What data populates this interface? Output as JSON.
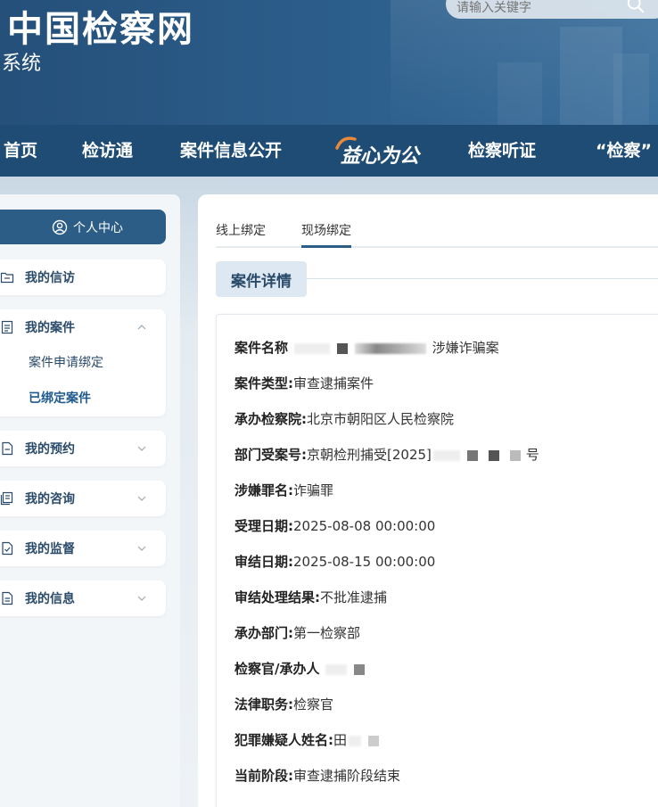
{
  "header": {
    "title": "中国检察网",
    "subtitle": "系统",
    "search_placeholder": "请输入关键字"
  },
  "nav": {
    "items": [
      {
        "label": "首页"
      },
      {
        "label": "检访通"
      },
      {
        "label": "案件信息公开"
      },
      {
        "label": "益心为公"
      },
      {
        "label": "检察听证"
      },
      {
        "label": "“检察”"
      }
    ]
  },
  "sidebar": {
    "personal_center": "个人中心",
    "menus": [
      {
        "label": "我的信访",
        "icon": "folder-icon"
      },
      {
        "label": "我的案件",
        "icon": "document-icon",
        "expanded": true,
        "children": [
          {
            "label": "案件申请绑定"
          },
          {
            "label": "已绑定案件"
          }
        ]
      },
      {
        "label": "我的预约",
        "icon": "calendar-doc-icon"
      },
      {
        "label": "我的咨询",
        "icon": "consult-icon"
      },
      {
        "label": "我的监督",
        "icon": "check-doc-icon"
      },
      {
        "label": "我的信息",
        "icon": "info-doc-icon"
      }
    ]
  },
  "main": {
    "tabs": [
      {
        "label": "线上绑定"
      },
      {
        "label": "现场绑定"
      }
    ],
    "active_tab": 1,
    "section_title": "案件详情",
    "details": [
      {
        "label": "案件名称",
        "value": "涉嫌诈骗案"
      },
      {
        "label": "案件类型:",
        "value": "审查逮捕案件"
      },
      {
        "label": "承办检察院:",
        "value": "北京市朝阳区人民检察院"
      },
      {
        "label": "部门受案号:",
        "value": "京朝检刑捕受[2025]",
        "value_suffix": "号"
      },
      {
        "label": "涉嫌罪名:",
        "value": "诈骗罪"
      },
      {
        "label": "受理日期:",
        "value": "2025-08-08 00:00:00"
      },
      {
        "label": "审结日期:",
        "value": "2025-08-15 00:00:00"
      },
      {
        "label": "审结处理结果:",
        "value": "不批准逮捕"
      },
      {
        "label": "承办部门:",
        "value": "第一检察部"
      },
      {
        "label": "检察官/承办人",
        "value": ""
      },
      {
        "label": "法律职务:",
        "value": "检察官"
      },
      {
        "label": "犯罪嫌疑人姓名:",
        "value": "田"
      },
      {
        "label": "当前阶段:",
        "value": "审查逮捕阶段结束"
      }
    ]
  }
}
